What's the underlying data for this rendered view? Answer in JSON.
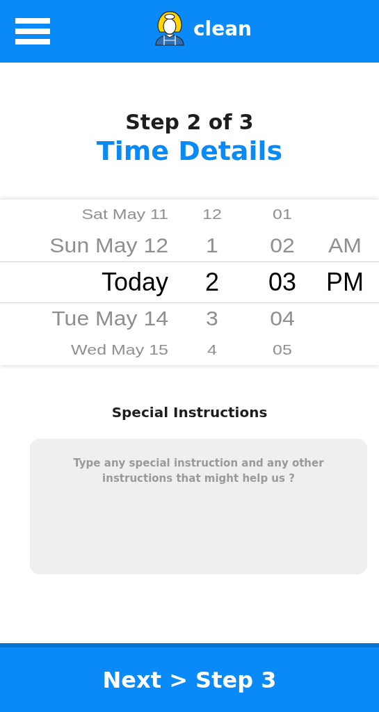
{
  "header": {
    "brand": "clean"
  },
  "step": {
    "counter": "Step 2 of 3",
    "title": "Time Details"
  },
  "picker": {
    "rows": [
      {
        "date": "Sat May 11",
        "hour": "12",
        "minute": "01",
        "selected": false
      },
      {
        "date": "Sun May 12",
        "hour": "1",
        "minute": "02",
        "period": "AM",
        "selected": false
      },
      {
        "date": "Today",
        "hour": "2",
        "minute": "03",
        "period": "PM",
        "selected": true
      },
      {
        "date": "Tue May 14",
        "hour": "3",
        "minute": "04",
        "selected": false
      },
      {
        "date": "Wed May 15",
        "hour": "4",
        "minute": "05",
        "selected": false
      }
    ]
  },
  "instructions": {
    "label": "Special Instructions",
    "placeholder": "Type any special instruction and any other instructions that might help us ?"
  },
  "next_button": {
    "label": "Next > Step 3"
  }
}
